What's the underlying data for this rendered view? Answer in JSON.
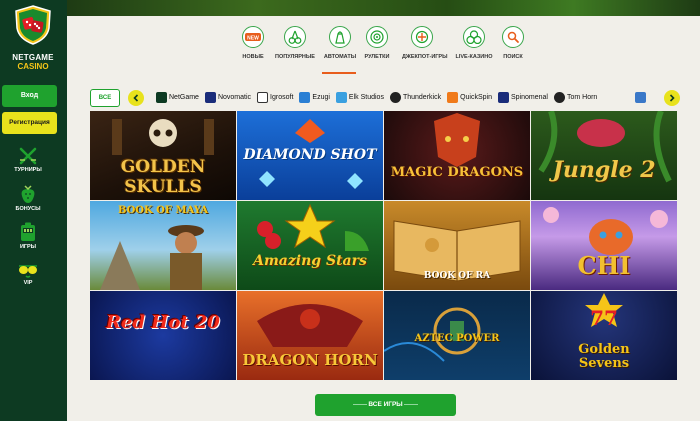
{
  "sidebar": {
    "logo_line1": "NETGAME",
    "logo_line2": "CASINO",
    "login": "Вход",
    "register": "Регистрация",
    "items": [
      {
        "label": "ТУРНИРЫ",
        "icon": "swords-icon"
      },
      {
        "label": "БОНУСЫ",
        "icon": "strawberry-icon"
      },
      {
        "label": "ИГРЫ",
        "icon": "slot-machine-icon"
      },
      {
        "label": "VIP",
        "icon": "sunglasses-icon"
      }
    ]
  },
  "categories": [
    {
      "label": "НОВЫЕ",
      "icon": "new-badge-icon"
    },
    {
      "label": "ПОПУЛЯРНЫЕ",
      "icon": "cherries-icon"
    },
    {
      "label": "АВТОМАТЫ",
      "icon": "fruit-slot-icon",
      "active": true
    },
    {
      "label": "РУЛЕТКИ",
      "icon": "roulette-icon"
    },
    {
      "label": "ДЖЕКПОТ-ИГРЫ",
      "icon": "jackpot-icon"
    },
    {
      "label": "LIVE-КАЗИНО",
      "icon": "chips-icon"
    },
    {
      "label": "ПОИСК",
      "icon": "search-icon"
    }
  ],
  "providers": {
    "all_label": "ВСЕ",
    "items": [
      "NetGame",
      "Novomatic",
      "Igrosoft",
      "Ezugi",
      "Elk Studios",
      "Thunderkick",
      "QuickSpin",
      "Spinomenal",
      "Tom Horn"
    ]
  },
  "games": [
    {
      "title": "GOLDEN SKULLS"
    },
    {
      "title": "DIAMOND SHOT"
    },
    {
      "title": "MAGIC DRAGONS"
    },
    {
      "title": "Jungle 2"
    },
    {
      "title": "BOOK OF MAYA"
    },
    {
      "title": "Amazing Stars"
    },
    {
      "title": "BOOK OF RA"
    },
    {
      "title": "CHI"
    },
    {
      "title": "Red Hot 20"
    },
    {
      "title": "DRAGON HORN"
    },
    {
      "title": "AZTEC POWER"
    },
    {
      "title": "Golden Sevens"
    }
  ],
  "all_games_button": "ВСЕ ИГРЫ",
  "colors": {
    "sidebar": "#0d3a22",
    "green": "#1fa22e",
    "yellow": "#e8e21c",
    "accent": "#e85d1c"
  }
}
